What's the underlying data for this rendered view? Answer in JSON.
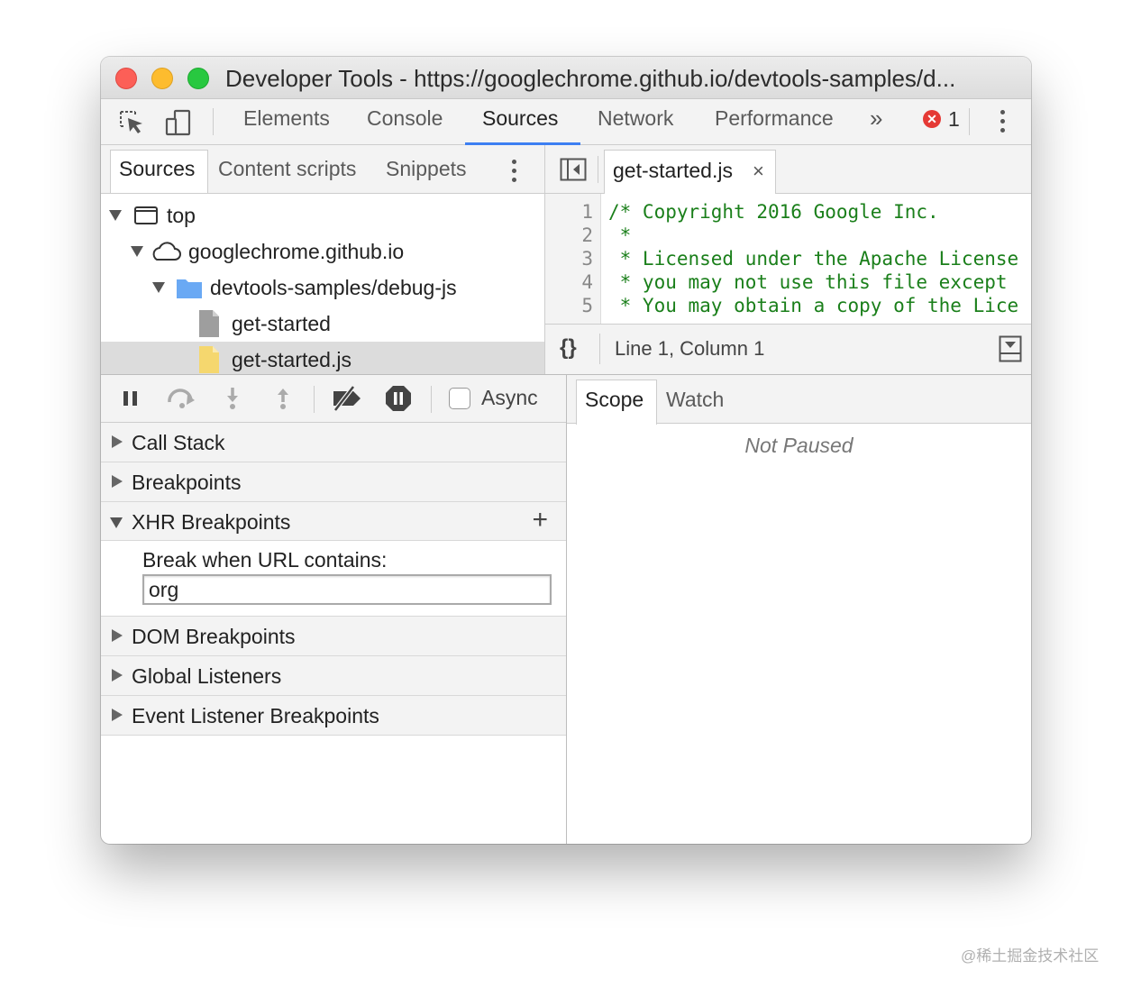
{
  "window": {
    "title": "Developer Tools - https://googlechrome.github.io/devtools-samples/d..."
  },
  "main_tabs": [
    "Elements",
    "Console",
    "Sources",
    "Network",
    "Performance"
  ],
  "active_main_tab": "Sources",
  "more_tabs_label": "»",
  "error_count": "1",
  "navigator": {
    "tabs": [
      "Sources",
      "Content scripts",
      "Snippets"
    ],
    "active_tab": "Sources",
    "tree": [
      {
        "label": "top",
        "icon": "frame-icon",
        "level": 0,
        "expanded": true
      },
      {
        "label": "googlechrome.github.io",
        "icon": "cloud-icon",
        "level": 1,
        "expanded": true
      },
      {
        "label": "devtools-samples/debug-js",
        "icon": "folder-icon",
        "level": 2,
        "expanded": true
      },
      {
        "label": "get-started",
        "icon": "file-icon",
        "level": 3
      },
      {
        "label": "get-started.js",
        "icon": "js-file-icon",
        "level": 3,
        "selected": true
      }
    ]
  },
  "editor": {
    "open_file": "get-started.js",
    "close_label": "×",
    "line_numbers": [
      "1",
      "2",
      "3",
      "4",
      "5"
    ],
    "lines": [
      "/* Copyright 2016 Google Inc.",
      " *",
      " * Licensed under the Apache License",
      " * you may not use this file except",
      " * You may obtain a copy of the Lice"
    ],
    "status": "Line 1, Column 1",
    "pretty_print_label": "{}"
  },
  "debugger": {
    "async_label": "Async",
    "panes": {
      "call_stack": "Call Stack",
      "breakpoints": "Breakpoints",
      "xhr_breakpoints": "XHR Breakpoints",
      "dom_breakpoints": "DOM Breakpoints",
      "global_listeners": "Global Listeners",
      "event_listener_breakpoints": "Event Listener Breakpoints"
    },
    "xhr": {
      "label": "Break when URL contains:",
      "value": "org",
      "add_label": "+"
    }
  },
  "scope": {
    "tabs": [
      "Scope",
      "Watch"
    ],
    "active_tab": "Scope",
    "status": "Not Paused"
  },
  "watermark": "@稀土掘金技术社区",
  "colors": {
    "accent": "#3d7ff2",
    "code_comment": "#1a7f1a",
    "error": "#e53935",
    "folder": "#6aa9f4",
    "js_file": "#f5d76e"
  }
}
